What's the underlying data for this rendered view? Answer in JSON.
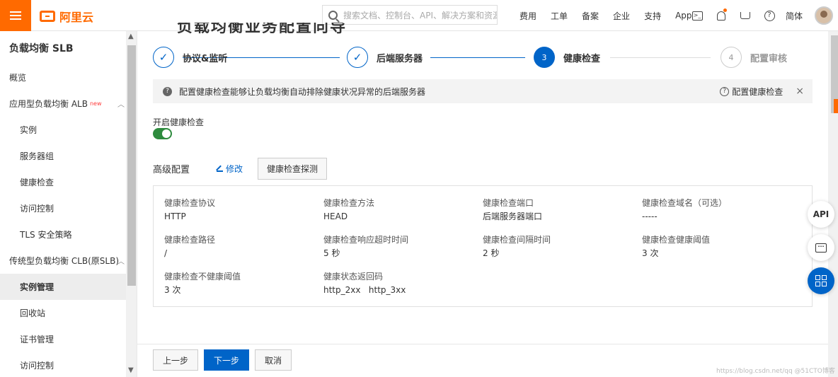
{
  "topbar": {
    "logo_text": "阿里云",
    "search_placeholder": "搜索文档、控制台、API、解决方案和资源",
    "nav": [
      "费用",
      "工单",
      "备案",
      "企业",
      "支持",
      "App"
    ],
    "lang": "简体",
    "icons": [
      "terminal-icon",
      "bell-icon",
      "cart-icon",
      "help-icon"
    ]
  },
  "sidebar": {
    "title": "负载均衡 SLB",
    "items": [
      {
        "label": "概览",
        "level": 1
      },
      {
        "label": "应用型负载均衡 ALB",
        "level": 1,
        "tag": "new",
        "caret": "^"
      },
      {
        "label": "实例",
        "level": 2
      },
      {
        "label": "服务器组",
        "level": 2
      },
      {
        "label": "健康检查",
        "level": 2
      },
      {
        "label": "访问控制",
        "level": 2
      },
      {
        "label": "TLS 安全策略",
        "level": 2
      },
      {
        "label": "传统型负载均衡 CLB(原SLB)",
        "level": 1,
        "caret": "^"
      },
      {
        "label": "实例管理",
        "level": 2,
        "active": true
      },
      {
        "label": "回收站",
        "level": 2
      },
      {
        "label": "证书管理",
        "level": 2
      },
      {
        "label": "访问控制",
        "level": 2
      }
    ]
  },
  "page": {
    "cut_title": "负载均衡业务配置向导"
  },
  "steps": [
    {
      "num": "✓",
      "label": "协议&监听",
      "state": "done"
    },
    {
      "num": "✓",
      "label": "后端服务器",
      "state": "done"
    },
    {
      "num": "3",
      "label": "健康检查",
      "state": "current"
    },
    {
      "num": "4",
      "label": "配置审核",
      "state": "wait"
    }
  ],
  "tip": {
    "text": "配置健康检查能够让负载均衡自动排除健康状况异常的后端服务器",
    "link": "配置健康检查",
    "close": "×"
  },
  "health": {
    "enable_label": "开启健康检查",
    "enabled": true,
    "adv_label": "高级配置",
    "edit_label": "修改",
    "probe_label": "健康检查探测"
  },
  "config": [
    {
      "k": "健康检查协议",
      "v": "HTTP"
    },
    {
      "k": "健康检查方法",
      "v": "HEAD"
    },
    {
      "k": "健康检查端口",
      "v": "后端服务器端口"
    },
    {
      "k": "健康检查域名（可选）",
      "v": "-----"
    },
    {
      "k": "健康检查路径",
      "v": "/"
    },
    {
      "k": "健康检查响应超时时间",
      "v": "5 秒"
    },
    {
      "k": "健康检查间隔时间",
      "v": "2 秒"
    },
    {
      "k": "健康检查健康阈值",
      "v": "3 次"
    },
    {
      "k": "健康检查不健康阈值",
      "v": "3 次"
    },
    {
      "k": "健康状态返回码",
      "v": "http_2xx   http_3xx"
    }
  ],
  "footer": {
    "prev": "上一步",
    "next": "下一步",
    "cancel": "取消"
  },
  "floats": [
    "API",
    "chat-icon",
    "apps-icon"
  ],
  "watermark": "https://blog.csdn.net/qq @51CTO博客",
  "colors": {
    "brand": "#ff6a00",
    "primary": "#0064c8",
    "toggle_on": "#2e8b3e"
  }
}
